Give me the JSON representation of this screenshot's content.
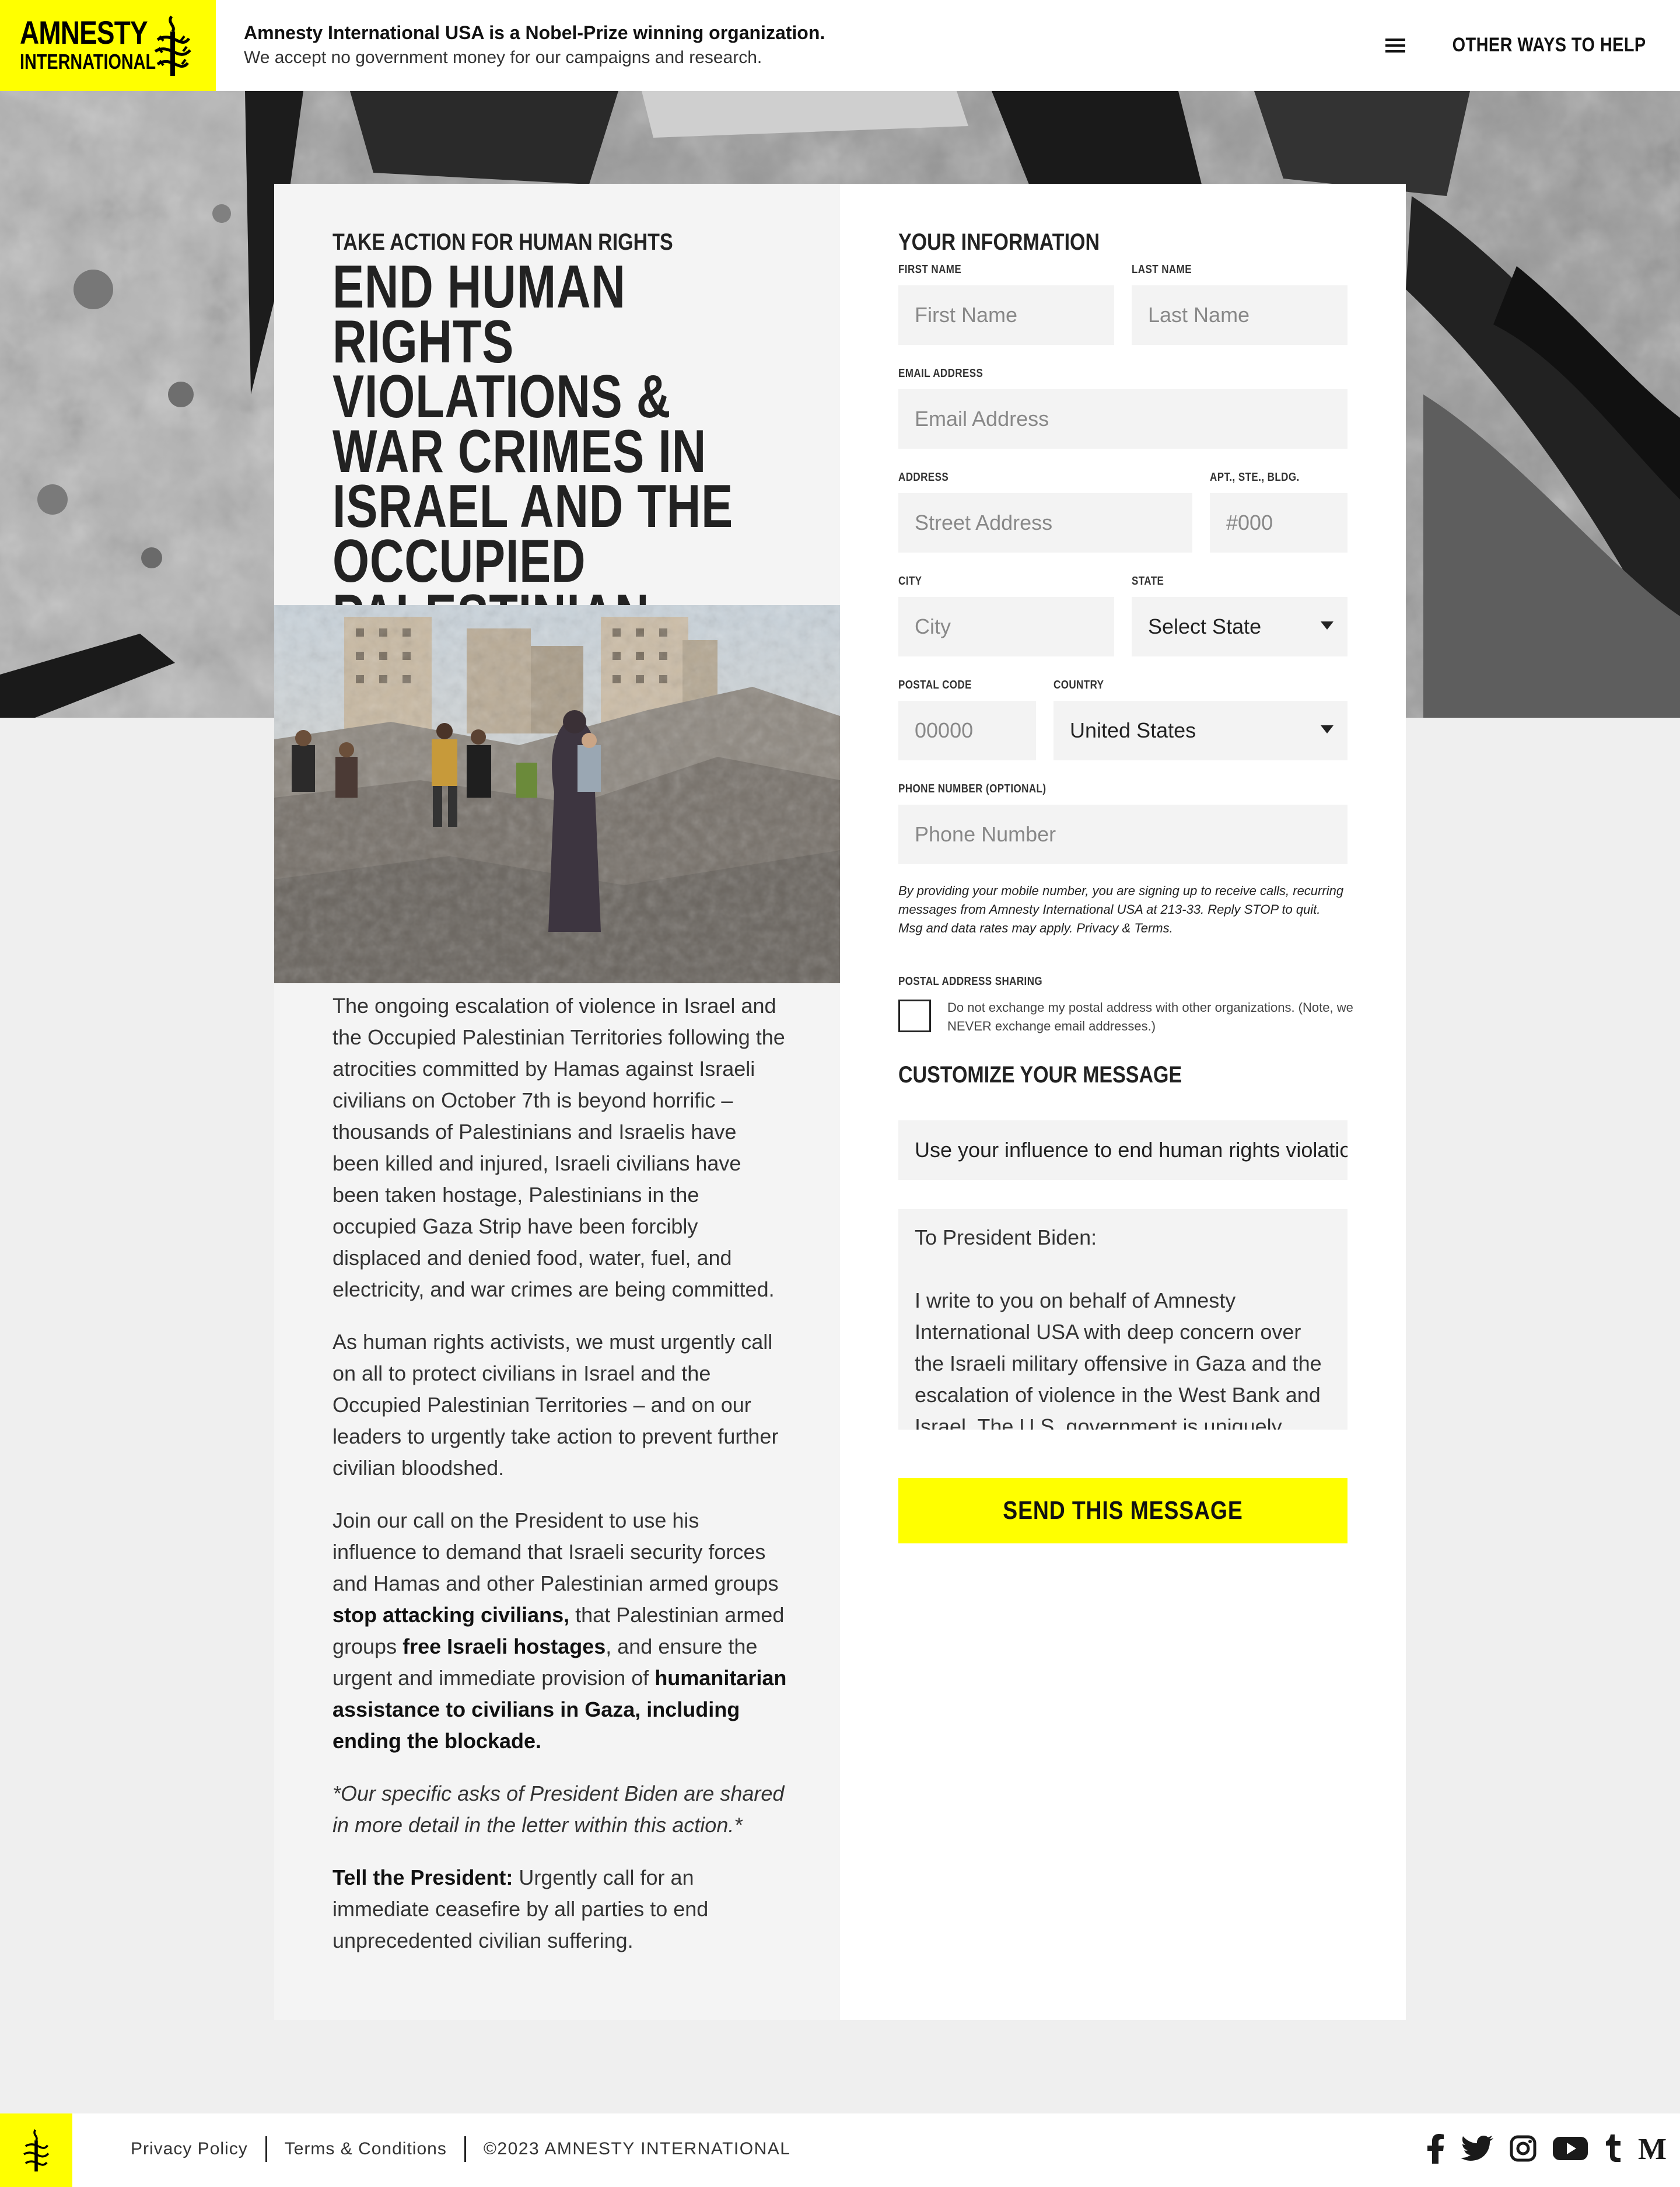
{
  "header": {
    "logo_line1": "AMNESTY",
    "logo_line2": "INTERNATIONAL",
    "tagline_bold": "Amnesty International USA is a Nobel-Prize winning organization.",
    "tagline": "We accept no government money for our campaigns and research.",
    "menu_label": "OTHER WAYS TO HELP"
  },
  "hero": {
    "kicker": "TAKE ACTION FOR HUMAN RIGHTS",
    "headline": "END HUMAN RIGHTS VIOLATIONS & WAR CRIMES IN ISRAEL AND THE OCCUPIED PALESTINIAN TERRITORIES"
  },
  "body": {
    "p1": "The ongoing escalation of violence in Israel and the Occupied Palestinian Territories following the atrocities committed by Hamas against Israeli civilians on October 7th is beyond horrific – thousands of Palestinians and Israelis have been killed and injured, Israeli civilians have been taken hostage, Palestinians in the occupied Gaza Strip have been forcibly displaced and denied food, water, fuel, and electricity, and war crimes are being committed.",
    "p2": "As human rights activists, we must urgently call on all to protect civilians in Israel and the Occupied Palestinian Territories – and on our leaders to urgently take action to prevent further civilian bloodshed.",
    "p3_a": "Join our call on the President to use his influence to demand that Israeli security forces and Hamas and other Palestinian armed groups ",
    "p3_b": "stop attacking civilians,",
    "p3_c": " that Palestinian armed groups ",
    "p3_d": "free Israeli hostages",
    "p3_e": ", and ensure the urgent and immediate provision of ",
    "p3_f": "humanitarian assistance to civilians in Gaza, including ending the blockade.",
    "p4": "*Our specific asks of President Biden are shared in more detail in the letter within this action.*",
    "p5_bold": "Tell the President:",
    "p5": " Urgently call for an immediate ceasefire by all parties to end unprecedented civilian suffering."
  },
  "form": {
    "title": "YOUR INFORMATION",
    "first_name_label": "FIRST NAME",
    "first_name_ph": "First Name",
    "last_name_label": "LAST NAME",
    "last_name_ph": "Last Name",
    "email_label": "EMAIL ADDRESS",
    "email_ph": "Email Address",
    "address_label": "ADDRESS",
    "address_ph": "Street Address",
    "apt_label": "APT., STE., BLDG.",
    "apt_ph": "#000",
    "city_label": "CITY",
    "city_ph": "City",
    "state_label": "STATE",
    "state_value": "Select State",
    "postal_label": "POSTAL CODE",
    "postal_ph": "00000",
    "country_label": "COUNTRY",
    "country_value": "United States",
    "phone_label": "PHONE NUMBER (OPTIONAL)",
    "phone_ph": "Phone Number",
    "disclaimer": "By providing your mobile number, you are signing up to receive calls, recurring messages from Amnesty International USA at 213-33. Reply STOP to quit. Msg and data rates may apply. Privacy & Terms.",
    "sharing_label": "POSTAL ADDRESS SHARING",
    "sharing_text": "Do not exchange my postal address with other organizations. (Note, we NEVER exchange email addresses.)",
    "customize_title": "CUSTOMIZE YOUR MESSAGE",
    "subject": "Use your influence to end human rights violations",
    "letter_salutation": "To President Biden:",
    "letter_body": "I write to you on behalf of Amnesty International USA with deep concern over the Israeli military offensive in Gaza and the escalation of violence in the West Bank and Israel. The U.S. government is uniquely",
    "send_label": "SEND THIS MESSAGE"
  },
  "footer": {
    "privacy": "Privacy Policy",
    "terms": "Terms & Conditions",
    "copyright": "©2023 AMNESTY INTERNATIONAL",
    "social": [
      "facebook-icon",
      "twitter-icon",
      "instagram-icon",
      "youtube-icon",
      "tumblr-icon",
      "medium-icon"
    ]
  },
  "colors": {
    "brand_yellow": "#ffff00",
    "text_dark": "#222222",
    "field_bg": "#f3f3f3",
    "page_bg": "#efefef"
  }
}
